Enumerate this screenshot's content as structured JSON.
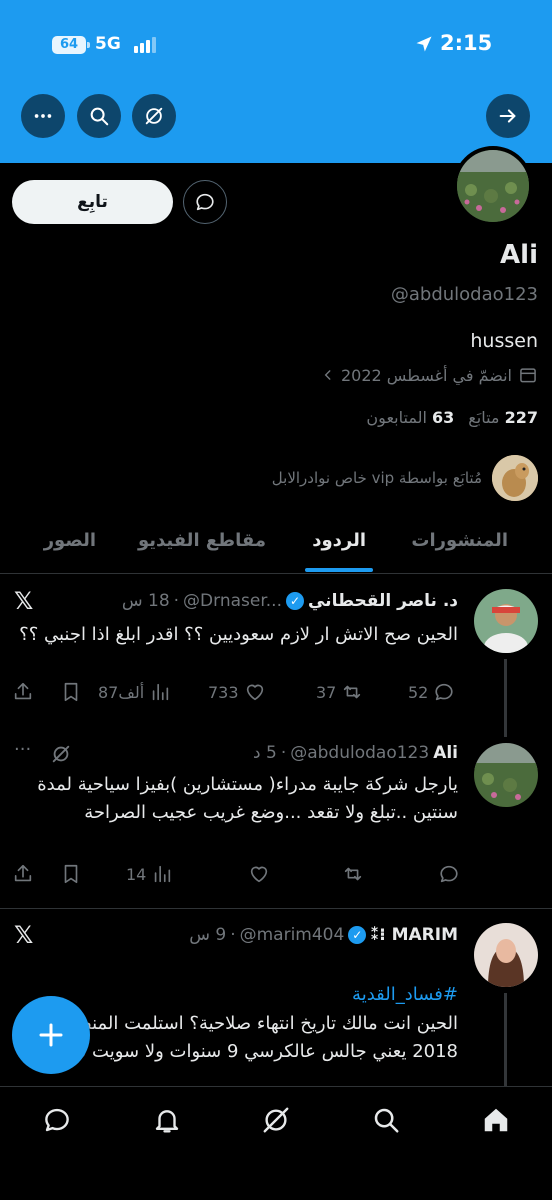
{
  "status_bar": {
    "battery": "64",
    "network": "5G",
    "time": "2:15"
  },
  "header": {
    "more_icon": "more-icon",
    "search_icon": "search-icon",
    "grok_icon": "grok-icon",
    "back_icon": "arrow-right-icon"
  },
  "profile": {
    "follow_label": "تابِع",
    "name": "Ali",
    "handle": "@abdulodao123",
    "bio": "hussen",
    "joined": "انضمّ في أغسطس 2022",
    "following_count": "227",
    "following_label": "متابَع",
    "followers_count": "63",
    "followers_label": "المتابعون",
    "followed_by": "مُتابَع بواسطة vip خاص نوادرالابل"
  },
  "tabs": [
    "المنشورات",
    "الردود",
    "مقاطع الفيديو",
    "الصور"
  ],
  "active_tab": "الردود",
  "tweets": [
    {
      "name": "د. ناصر القحطاني",
      "handle": "@Drnaser...",
      "time": "18 س",
      "text": "الحين صح الاتش ار لازم سعوديين ؟؟ اقدر ابلغ اذا اجنبي ؟؟",
      "replies": "52",
      "retweets": "37",
      "likes": "733",
      "views": "87ألف"
    },
    {
      "name": "Ali",
      "handle": "@abdulodao123",
      "time": "5 د",
      "text": "يارجل شركة جايبة مدراء( مستشارين )بفيزا سياحية لمدة سنتين ..تبلغ ولا تقعد ...وضع غريب عجيب الصراحة",
      "replies": "",
      "retweets": "",
      "likes": "",
      "views": "14"
    },
    {
      "name": "MARIM ⁝⁑",
      "handle": "@marim404",
      "time": "9 س",
      "hashtag": "#فساد_القدية",
      "text": "الحين انت مالك تاريخ انتهاء صلاحية؟ استلمت المنصب 2018 يعني جالس عالكرسي 9 سنوات ولا سويت شي"
    }
  ],
  "x_logo": "𝕏",
  "colors": {
    "accent": "#1d9bf0",
    "background": "#000000",
    "muted": "#71767b"
  }
}
